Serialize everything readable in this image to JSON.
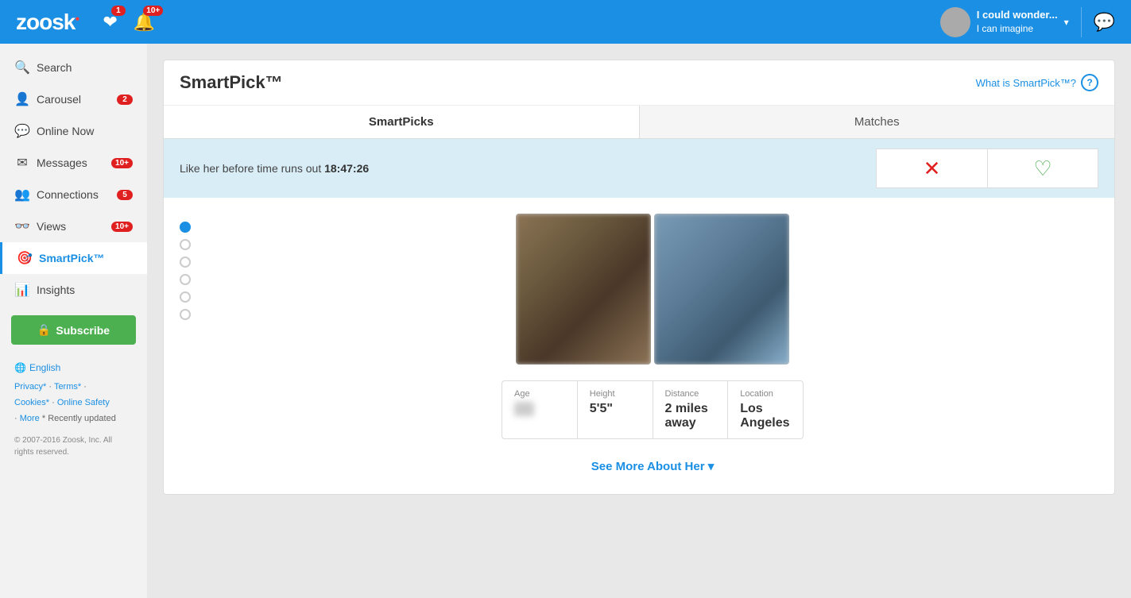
{
  "topnav": {
    "logo": "zoosk",
    "notifications_badge": "1",
    "alerts_badge": "10+",
    "user": {
      "name": "I could wonder...",
      "subtitle": "I can imagine",
      "avatar_bg": "#aaa"
    },
    "chat_icon": "💬"
  },
  "sidebar": {
    "items": [
      {
        "id": "search",
        "label": "Search",
        "icon": "🔍",
        "badge": null,
        "active": false
      },
      {
        "id": "carousel",
        "label": "Carousel",
        "icon": "👤",
        "badge": "2",
        "active": false
      },
      {
        "id": "online-now",
        "label": "Online Now",
        "icon": "💬",
        "badge": null,
        "active": false
      },
      {
        "id": "messages",
        "label": "Messages",
        "icon": "✉",
        "badge": "10+",
        "active": false
      },
      {
        "id": "connections",
        "label": "Connections",
        "icon": "👥",
        "badge": "5",
        "active": false
      },
      {
        "id": "views",
        "label": "Views",
        "icon": "👓",
        "badge": "10+",
        "active": false
      },
      {
        "id": "smartpick",
        "label": "SmartPick™",
        "icon": "🎯",
        "badge": null,
        "active": true
      },
      {
        "id": "insights",
        "label": "Insights",
        "icon": "📊",
        "badge": null,
        "active": false
      }
    ],
    "subscribe_label": "Subscribe",
    "language": "English",
    "footer_links": {
      "privacy": "Privacy*",
      "terms": "Terms*",
      "cookies": "Cookies*",
      "online_safety": "Online Safety",
      "more": "More",
      "recently_updated": "* Recently updated"
    },
    "copyright": "© 2007-2016 Zoosk, Inc. All rights reserved."
  },
  "smartpick": {
    "title": "SmartPick™",
    "help_link": "What is SmartPick™?",
    "tabs": [
      {
        "id": "smartpicks",
        "label": "SmartPicks",
        "active": true
      },
      {
        "id": "matches",
        "label": "Matches",
        "active": false
      }
    ],
    "timer": {
      "prefix": "Like her before time runs out",
      "time": "18:47:26"
    },
    "dislike_icon": "✕",
    "like_icon": "♡",
    "profile": {
      "age_label": "Age",
      "age_value": "—",
      "height_label": "Height",
      "height_value": "5'5\"",
      "distance_label": "Distance",
      "distance_value": "2 miles away",
      "location_label": "Location",
      "location_value": "Los Angeles"
    },
    "see_more": "See More About Her ▾",
    "photo_dots": [
      1,
      2,
      3,
      4,
      5,
      6
    ],
    "active_dot": 1
  }
}
